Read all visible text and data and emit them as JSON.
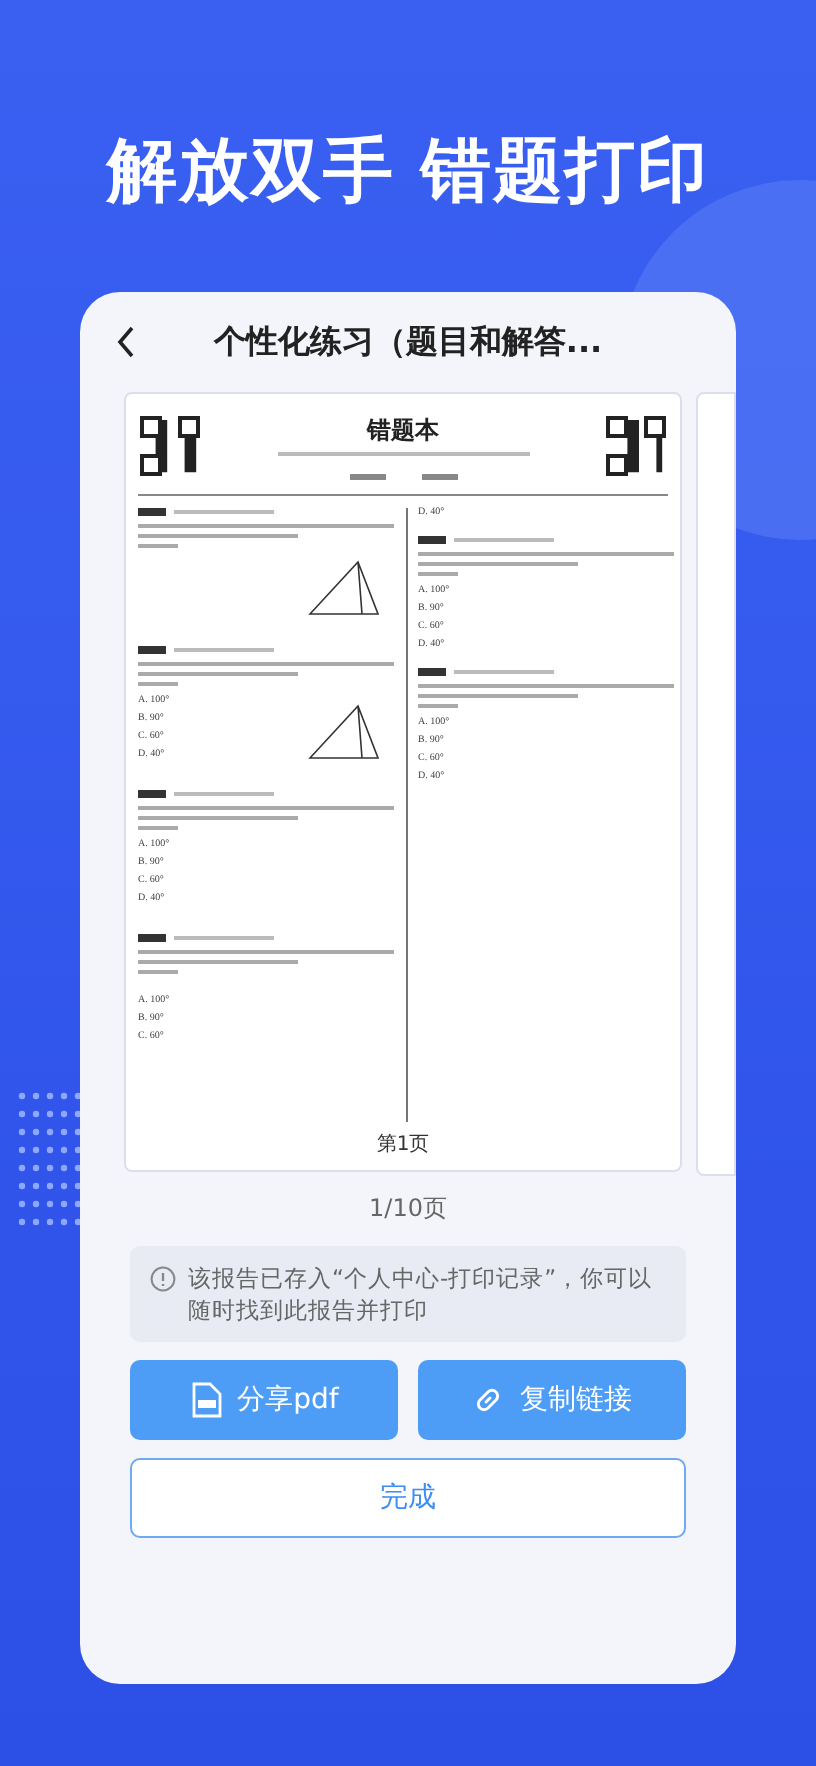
{
  "headline": "解放双手 错题打印",
  "screen": {
    "title": "个性化练习（题目和解答...",
    "document": {
      "title": "错题本",
      "first_line": "D. 40°",
      "page_label": "第1页",
      "left": [
        {
          "figure": true
        },
        {
          "figure": true,
          "options": [
            "A. 100°",
            "B. 90°",
            "C. 60°",
            "D. 40°"
          ]
        },
        {
          "figure": false,
          "options": [
            "A. 100°",
            "B. 90°",
            "C. 60°",
            "D. 40°"
          ]
        },
        {
          "figure": false,
          "options": [
            "A. 100°",
            "B. 90°",
            "C. 60°"
          ]
        }
      ],
      "right": [
        {
          "options": [
            "A. 100°",
            "B. 90°",
            "C. 60°",
            "D. 40°"
          ]
        },
        {
          "options": [
            "A. 100°",
            "B. 90°",
            "C. 60°",
            "D. 40°"
          ]
        }
      ]
    },
    "pager": "1/10页",
    "notice": "该报告已存入“个人中心-打印记录”，你可以随时找到此报告并打印",
    "buttons": [
      {
        "kind": "pdf",
        "label": "分享pdf"
      },
      {
        "kind": "link",
        "label": "复制链接"
      }
    ],
    "done": "完成"
  }
}
